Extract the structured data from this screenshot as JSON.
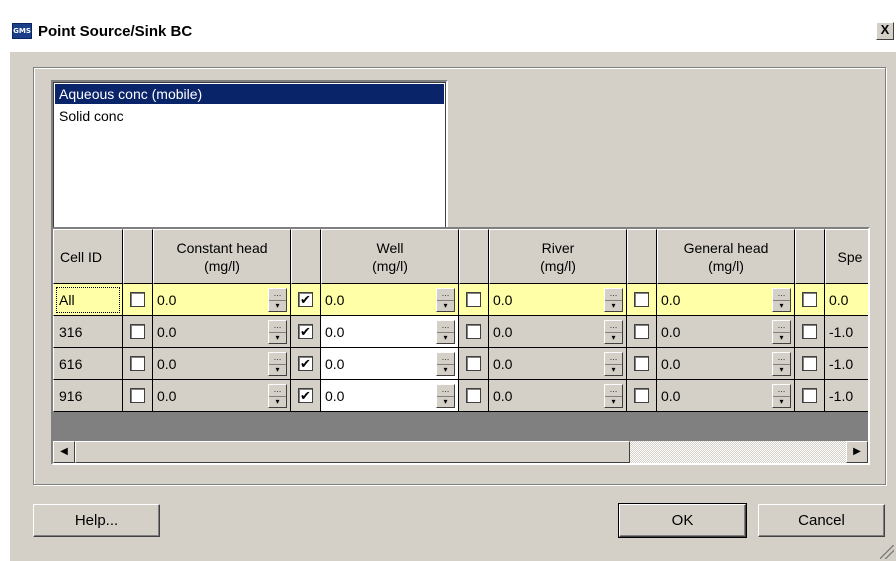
{
  "window": {
    "title": "Point Source/Sink BC",
    "app_icon": "GMS",
    "close_label": "X"
  },
  "species_list": {
    "items": [
      "Aqueous conc (mobile)",
      "Solid conc"
    ],
    "selected_index": 0
  },
  "grid": {
    "headers": {
      "cell_id": "Cell ID",
      "constant_head": "Constant head",
      "well": "Well",
      "river": "River",
      "general_head": "General head",
      "last": "Spe",
      "unit": "(mg/l)"
    },
    "rows": [
      {
        "id": "All",
        "checks": [
          false,
          true,
          false,
          false,
          false
        ],
        "values": [
          "0.0",
          "0.0",
          "0.0",
          "0.0",
          "0.0"
        ]
      },
      {
        "id": "316",
        "checks": [
          false,
          true,
          false,
          false,
          false
        ],
        "values": [
          "0.0",
          "0.0",
          "0.0",
          "0.0",
          "-1.0"
        ]
      },
      {
        "id": "616",
        "checks": [
          false,
          true,
          false,
          false,
          false
        ],
        "values": [
          "0.0",
          "0.0",
          "0.0",
          "0.0",
          "-1.0"
        ]
      },
      {
        "id": "916",
        "checks": [
          false,
          true,
          false,
          false,
          false
        ],
        "values": [
          "0.0",
          "0.0",
          "0.0",
          "0.0",
          "-1.0"
        ]
      }
    ],
    "check_mark": "✔",
    "spin_glyph": "…",
    "spin_down_glyph": "▾"
  },
  "buttons": {
    "help": "Help...",
    "ok": "OK",
    "cancel": "Cancel"
  },
  "scroll": {
    "left_arrow": "◀",
    "right_arrow": "▶"
  },
  "colors": {
    "selection": "#0a246a",
    "edit_row": "#ffffa8",
    "face": "#d4d0c8"
  }
}
